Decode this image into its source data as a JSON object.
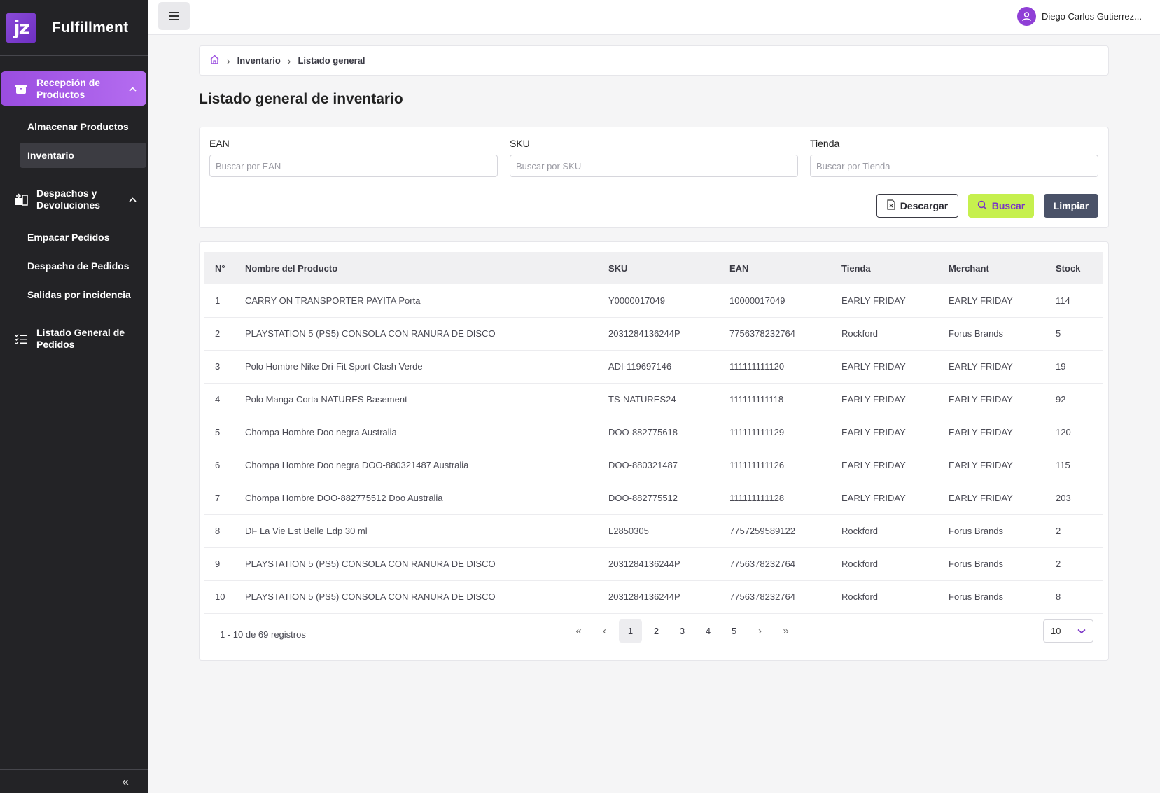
{
  "app": {
    "logo_text": "jz",
    "name": "Fulfillment"
  },
  "sidebar": {
    "groups": [
      {
        "label": "Recepción de Productos",
        "icon": "package-icon",
        "items": [
          "Almacenar Productos",
          "Inventario"
        ]
      },
      {
        "label": "Despachos y Devoluciones",
        "icon": "dispatch-icon",
        "items": [
          "Empacar Pedidos",
          "Despacho de Pedidos",
          "Salidas por incidencia"
        ]
      },
      {
        "label": "Listado General de Pedidos",
        "icon": "list-icon"
      }
    ],
    "collapse_icon": "double-chevron-left-icon",
    "collapse_glyph": "«"
  },
  "topbar": {
    "menu_icon": "hamburger-icon",
    "user_name": "Diego Carlos Gutierrez..."
  },
  "breadcrumb": {
    "home_icon": "home-icon",
    "items": [
      "Inventario",
      "Listado general"
    ],
    "sep": "›"
  },
  "page_title": "Listado general de inventario",
  "filters": {
    "ean": {
      "label": "EAN",
      "placeholder": "Buscar por EAN",
      "value": ""
    },
    "sku": {
      "label": "SKU",
      "placeholder": "Buscar por SKU",
      "value": ""
    },
    "store": {
      "label": "Tienda",
      "placeholder": "Buscar por Tienda",
      "value": ""
    },
    "download_label": "Descargar",
    "search_label": "Buscar",
    "clear_label": "Limpiar"
  },
  "table": {
    "headers": [
      "N°",
      "Nombre del Producto",
      "SKU",
      "EAN",
      "Tienda",
      "Merchant",
      "Stock"
    ],
    "rows": [
      [
        "1",
        "CARRY ON TRANSPORTER PAYITA Porta",
        "Y0000017049",
        "10000017049",
        "EARLY FRIDAY",
        "EARLY FRIDAY",
        "114"
      ],
      [
        "2",
        "PLAYSTATION 5 (PS5) CONSOLA CON RANURA DE DISCO",
        "2031284136244P",
        "7756378232764",
        "Rockford",
        "Forus Brands",
        "5"
      ],
      [
        "3",
        "Polo Hombre Nike Dri-Fit Sport Clash Verde",
        "ADI-119697146",
        "111111111120",
        "EARLY FRIDAY",
        "EARLY FRIDAY",
        "19"
      ],
      [
        "4",
        "Polo Manga Corta NATURES Basement",
        "TS-NATURES24",
        "111111111118",
        "EARLY FRIDAY",
        "EARLY FRIDAY",
        "92"
      ],
      [
        "5",
        "Chompa Hombre Doo negra Australia",
        "DOO-882775618",
        "111111111129",
        "EARLY FRIDAY",
        "EARLY FRIDAY",
        "120"
      ],
      [
        "6",
        "Chompa Hombre Doo negra DOO-880321487 Australia",
        "DOO-880321487",
        "111111111126",
        "EARLY FRIDAY",
        "EARLY FRIDAY",
        "115"
      ],
      [
        "7",
        "Chompa Hombre DOO-882775512 Doo Australia",
        "DOO-882775512",
        "111111111128",
        "EARLY FRIDAY",
        "EARLY FRIDAY",
        "203"
      ],
      [
        "8",
        "DF La Vie Est Belle Edp 30 ml",
        "L2850305",
        "7757259589122",
        "Rockford",
        "Forus Brands",
        "2"
      ],
      [
        "9",
        "PLAYSTATION 5 (PS5) CONSOLA CON RANURA DE DISCO",
        "2031284136244P",
        "7756378232764",
        "Rockford",
        "Forus Brands",
        "2"
      ],
      [
        "10",
        "PLAYSTATION 5 (PS5) CONSOLA CON RANURA DE DISCO",
        "2031284136244P",
        "7756378232764",
        "Rockford",
        "Forus Brands",
        "8"
      ]
    ]
  },
  "pagination": {
    "range_text": "1 - 10 de 69 registros",
    "first": "«",
    "prev": "‹",
    "pages": [
      "1",
      "2",
      "3",
      "4",
      "5"
    ],
    "current": "1",
    "next": "›",
    "last": "»",
    "page_size": "10"
  },
  "colors": {
    "accent": "#9a4de0",
    "search_button": "#c6f04e",
    "clear_button": "#4a5268",
    "sidebar": "#232326"
  }
}
